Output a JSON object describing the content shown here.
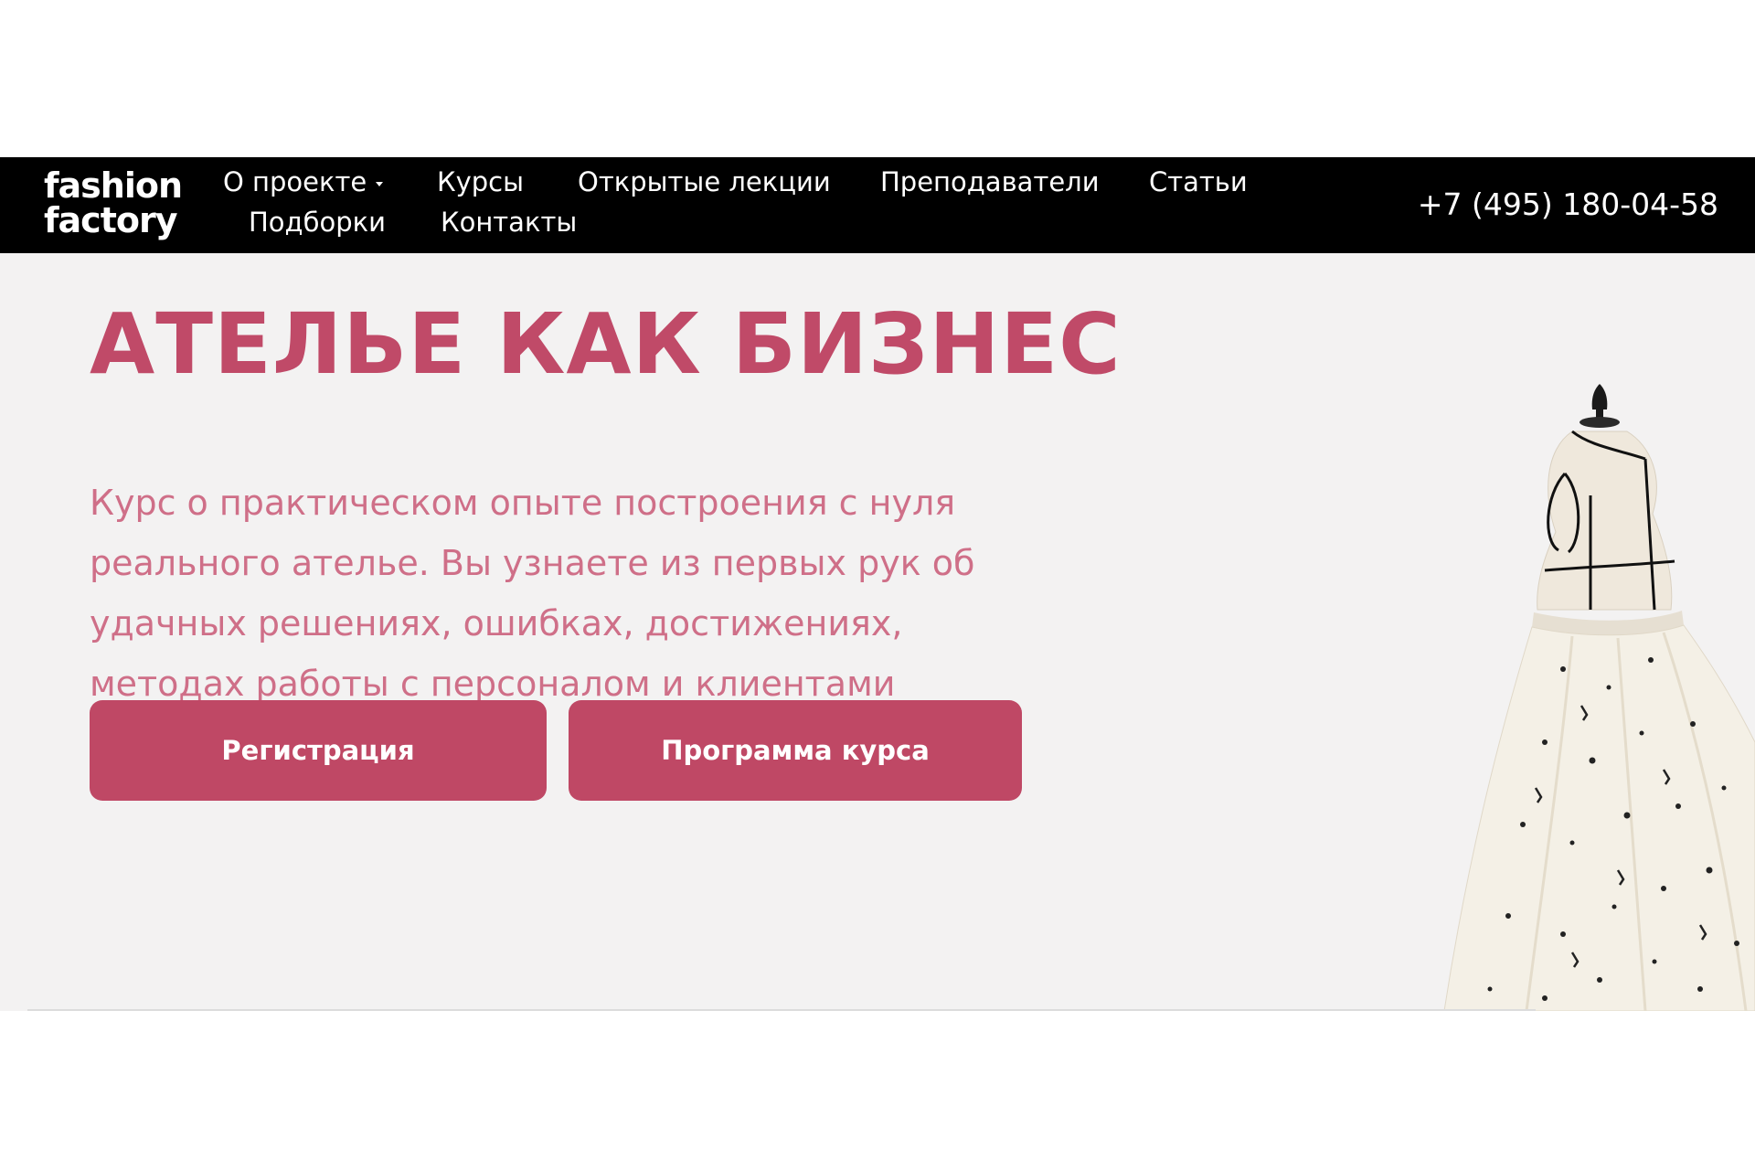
{
  "header": {
    "logo_line1": "fashion",
    "logo_line2": "factory",
    "menu": [
      {
        "label": "О проекте",
        "has_dropdown": true
      },
      {
        "label": "Курсы"
      },
      {
        "label": "Открытые лекции"
      },
      {
        "label": "Преподаватели"
      },
      {
        "label": "Статьи"
      },
      {
        "label": "Подборки"
      },
      {
        "label": "Контакты"
      }
    ],
    "phone": "+7 (495) 180-04-58"
  },
  "hero": {
    "title": "АТЕЛЬЕ КАК БИЗНЕС",
    "description": "Курс о практическом опыте построения с нуля реального ателье. Вы узнаете из первых рук об удачных решениях, ошибках, достижениях, методах работы с персоналом и клиентами",
    "buttons": {
      "register": "Регистрация",
      "program": "Программа курса"
    }
  },
  "colors": {
    "accent": "#bf4865",
    "title": "#c04a68",
    "text": "#cf6f88",
    "nav_bg": "#000000",
    "hero_bg": "#f3f2f2"
  }
}
